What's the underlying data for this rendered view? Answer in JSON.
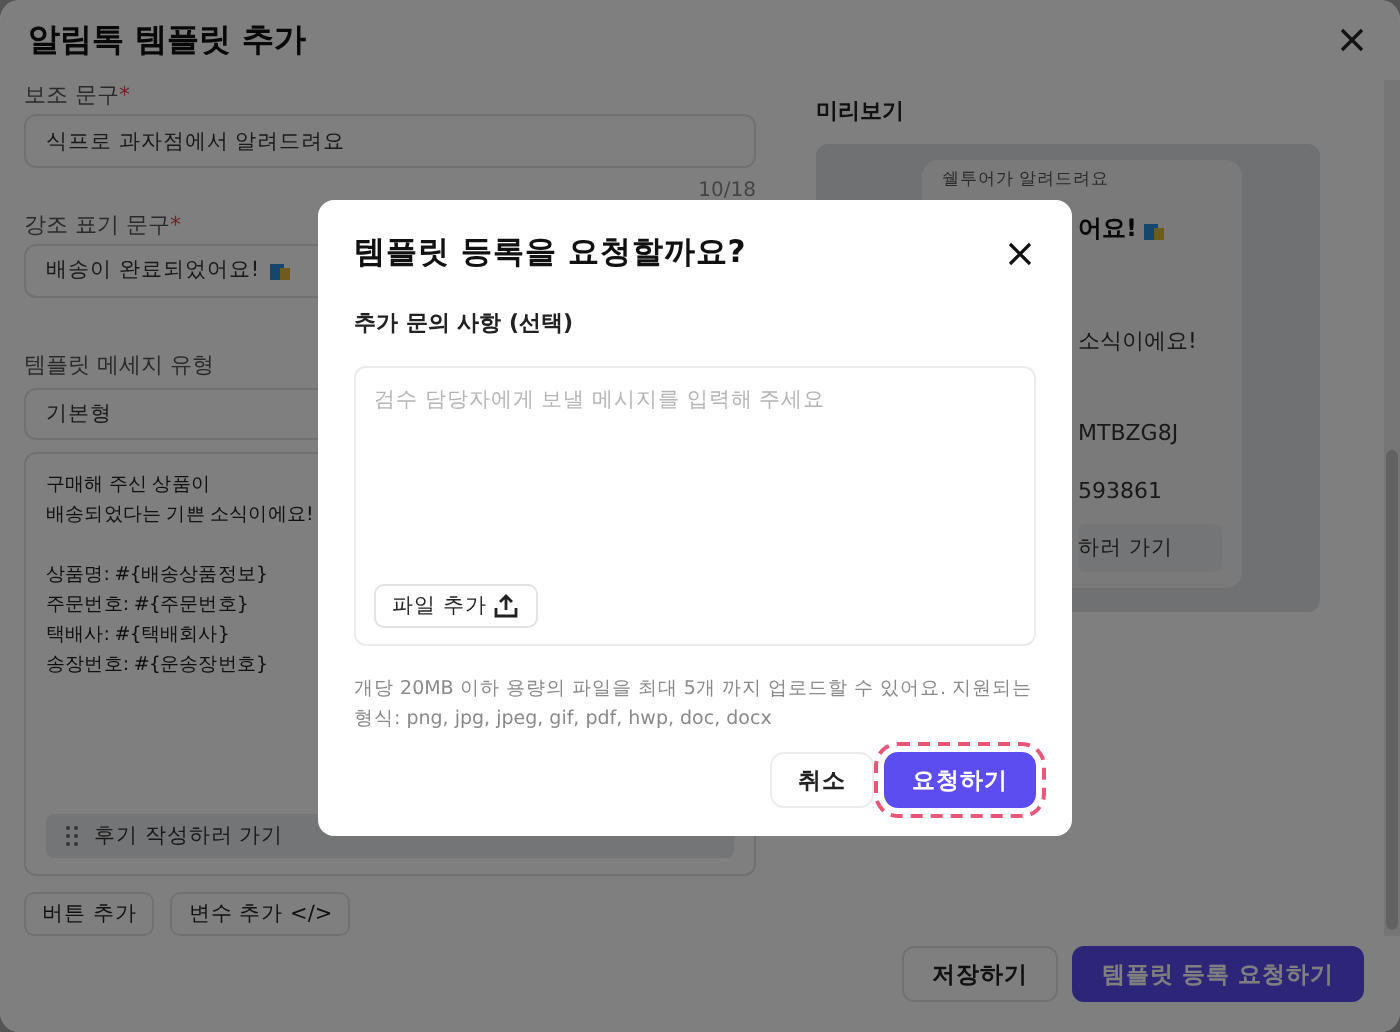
{
  "window": {
    "title": "알림톡 템플릿 추가"
  },
  "form": {
    "sub_text": {
      "label": "보조 문구",
      "required_mark": "*",
      "value": "식프로 과자점에서 알려드려요",
      "counter": "10/18"
    },
    "emphasis": {
      "label": "강조 표기 문구",
      "required_mark": "*",
      "value": "배송이 완료되었어요!"
    },
    "message_type": {
      "label": "템플릿 메세지 유형",
      "value": "기본형"
    },
    "body": {
      "paragraphs": [
        [
          "구매해 주신 상품이",
          "배송되었다는 기쁜 소식이에요!"
        ],
        [
          "상품명: #{배송상품정보}",
          "주문번호: #{주문번호}",
          "택배사: #{택배회사}",
          "송장번호: #{운송장번호}"
        ]
      ],
      "link_button": "후기 작성하러 가기"
    },
    "actions": [
      "버튼 추가",
      "변수 추가 </>"
    ]
  },
  "preview": {
    "title": "미리보기",
    "sender": "쉘투어가 알려드려요",
    "headline": "어요!",
    "lines": [
      "소식이에요!",
      "MTBZG8J",
      "593861"
    ],
    "button": "하러 가기"
  },
  "footer_buttons": [
    {
      "label": "저장하기",
      "kind": "secondary"
    },
    {
      "label": "템플릿 등록 요청하기",
      "kind": "primary"
    }
  ],
  "dialog": {
    "title": "템플릿 등록을 요청할까요?",
    "field_label": "추가 문의 사항 (선택)",
    "placeholder": "검수 담당자에게 보낼 메시지를 입력해 주세요",
    "attach_button": "파일 추가",
    "help": "개당 20MB 이하 용량의 파일을 최대 5개 까지 업로드할 수 있어요. 지원되는 형식: png, jpg, jpeg, gif, pdf, hwp, doc, docx",
    "buttons": [
      {
        "label": "취소",
        "kind": "secondary",
        "focused": false
      },
      {
        "label": "요청하기",
        "kind": "primary",
        "focused": true
      }
    ]
  }
}
